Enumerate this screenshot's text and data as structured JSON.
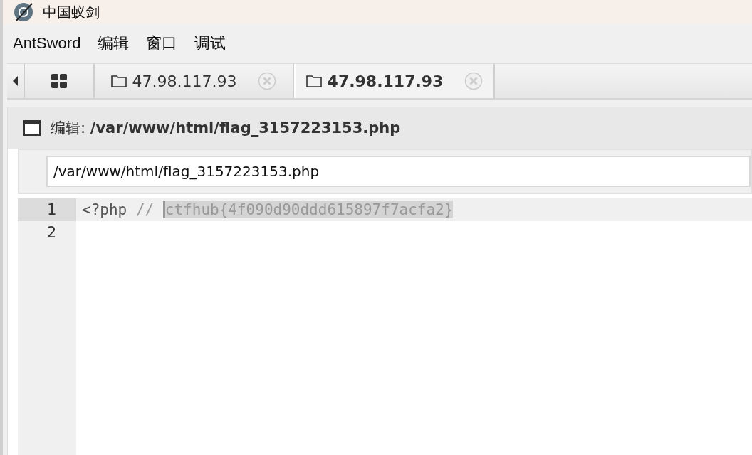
{
  "window": {
    "title": "中国蚁剑"
  },
  "menu": [
    "AntSword",
    "编辑",
    "窗口",
    "调试"
  ],
  "tabs": [
    {
      "kind": "home",
      "selected": false
    },
    {
      "kind": "host",
      "label": "47.98.117.93",
      "selected": false
    },
    {
      "kind": "host",
      "label": "47.98.117.93",
      "selected": true
    }
  ],
  "editor": {
    "title_prefix": "编辑:",
    "title_path": "/var/www/html/flag_3157223153.php",
    "path_value": "/var/www/html/flag_3157223153.php",
    "lines": [
      {
        "number": "1",
        "current": true,
        "code": "<?php",
        "comment": "//",
        "selection": "ctfhub{4f090d90ddd615897f7acfa2}"
      },
      {
        "number": "2",
        "current": false
      }
    ]
  }
}
